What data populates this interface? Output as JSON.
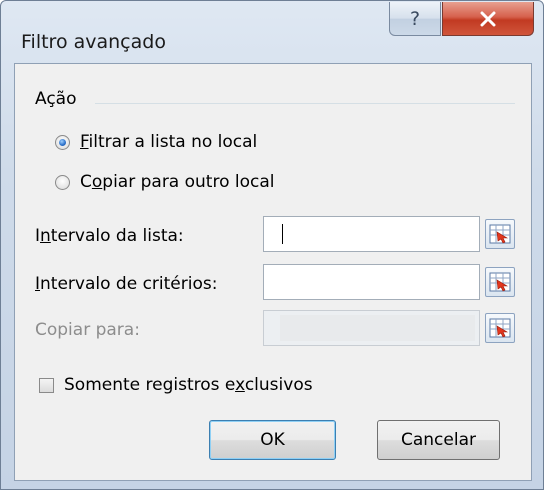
{
  "window": {
    "title": "Filtro avançado",
    "help_glyph": "?",
    "close_icon": "close-icon",
    "help_icon": "help-icon"
  },
  "action_group": {
    "label": "Ação",
    "options": [
      {
        "pre": "",
        "accel": "F",
        "post": "iltrar a lista no local",
        "checked": true
      },
      {
        "pre": "C",
        "accel": "o",
        "post": "piar para outro local",
        "checked": false
      }
    ]
  },
  "fields": [
    {
      "pre": "I",
      "accel": "n",
      "post": "tervalo da lista:",
      "value": "",
      "enabled": true,
      "has_caret": true
    },
    {
      "pre": "",
      "accel": "I",
      "post": "ntervalo de critérios:",
      "value": "",
      "enabled": true,
      "has_caret": false
    },
    {
      "pre": "Copiar para:",
      "accel": "",
      "post": "",
      "value": "",
      "enabled": false,
      "has_caret": false
    }
  ],
  "ref_button_icon": "range-select-icon",
  "unique_checkbox": {
    "pre": "Somente registros e",
    "accel": "x",
    "post": "clusivos",
    "checked": false
  },
  "buttons": {
    "ok": "OK",
    "cancel": "Cancelar"
  },
  "colors": {
    "close_red": "#c23a22",
    "accent_blue": "#3c7fb1"
  }
}
